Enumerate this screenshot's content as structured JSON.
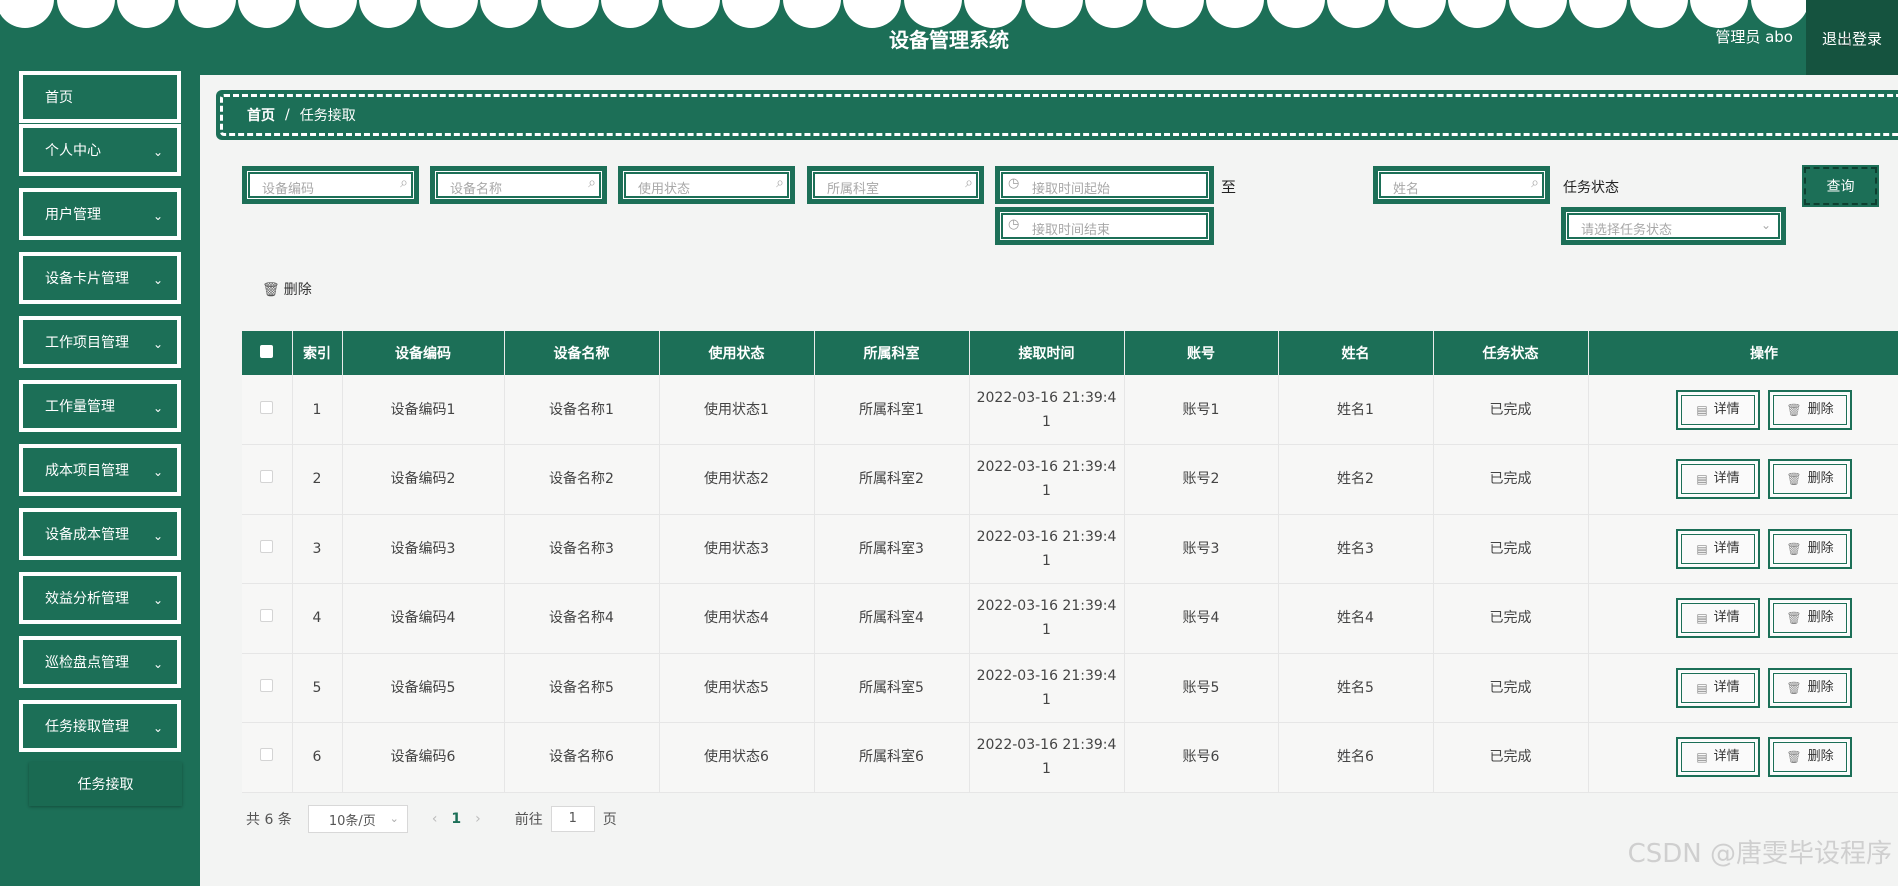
{
  "header": {
    "title": "设备管理系统",
    "user": "管理员 abo",
    "logout": "退出登录"
  },
  "sidebar": {
    "items": [
      {
        "label": "首页",
        "has_chevron": false
      },
      {
        "label": "个人中心",
        "has_chevron": true
      },
      {
        "label": "用户管理",
        "has_chevron": true
      },
      {
        "label": "设备卡片管理",
        "has_chevron": true
      },
      {
        "label": "工作项目管理",
        "has_chevron": true
      },
      {
        "label": "工作量管理",
        "has_chevron": true
      },
      {
        "label": "成本项目管理",
        "has_chevron": true
      },
      {
        "label": "设备成本管理",
        "has_chevron": true
      },
      {
        "label": "效益分析管理",
        "has_chevron": true
      },
      {
        "label": "巡检盘点管理",
        "has_chevron": true
      },
      {
        "label": "任务接取管理",
        "has_chevron": true
      }
    ],
    "submenu": "任务接取"
  },
  "breadcrumb": {
    "home": "首页",
    "sep": "/",
    "current": "任务接取"
  },
  "search": {
    "code_ph": "设备编码",
    "name_ph": "设备名称",
    "status_ph": "使用状态",
    "dept_ph": "所属科室",
    "start_ph": "接取时间起始",
    "to": "至",
    "end_ph": "接取时间结束",
    "person_ph": "姓名",
    "task_status_label": "任务状态",
    "task_status_ph": "请选择任务状态",
    "query": "查询"
  },
  "actions": {
    "bulk_delete": "删除"
  },
  "table": {
    "headers": [
      "索引",
      "设备编码",
      "设备名称",
      "使用状态",
      "所属科室",
      "接取时间",
      "账号",
      "姓名",
      "任务状态",
      "操作"
    ],
    "detail_label": "详情",
    "delete_label": "删除",
    "rows": [
      {
        "idx": "1",
        "code": "设备编码1",
        "name": "设备名称1",
        "status": "使用状态1",
        "dept": "所属科室1",
        "time1": "2022-03-16 21:39:4",
        "time2": "1",
        "account": "账号1",
        "person": "姓名1",
        "task": "已完成"
      },
      {
        "idx": "2",
        "code": "设备编码2",
        "name": "设备名称2",
        "status": "使用状态2",
        "dept": "所属科室2",
        "time1": "2022-03-16 21:39:4",
        "time2": "1",
        "account": "账号2",
        "person": "姓名2",
        "task": "已完成"
      },
      {
        "idx": "3",
        "code": "设备编码3",
        "name": "设备名称3",
        "status": "使用状态3",
        "dept": "所属科室3",
        "time1": "2022-03-16 21:39:4",
        "time2": "1",
        "account": "账号3",
        "person": "姓名3",
        "task": "已完成"
      },
      {
        "idx": "4",
        "code": "设备编码4",
        "name": "设备名称4",
        "status": "使用状态4",
        "dept": "所属科室4",
        "time1": "2022-03-16 21:39:4",
        "time2": "1",
        "account": "账号4",
        "person": "姓名4",
        "task": "已完成"
      },
      {
        "idx": "5",
        "code": "设备编码5",
        "name": "设备名称5",
        "status": "使用状态5",
        "dept": "所属科室5",
        "time1": "2022-03-16 21:39:4",
        "time2": "1",
        "account": "账号5",
        "person": "姓名5",
        "task": "已完成"
      },
      {
        "idx": "6",
        "code": "设备编码6",
        "name": "设备名称6",
        "status": "使用状态6",
        "dept": "所属科室6",
        "time1": "2022-03-16 21:39:4",
        "time2": "1",
        "account": "账号6",
        "person": "姓名6",
        "task": "已完成"
      }
    ]
  },
  "pager": {
    "total": "共 6 条",
    "size": "10条/页",
    "current": "1",
    "goto": "前往",
    "goto_value": "1",
    "page_suffix": "页"
  },
  "watermark": "CSDN @唐雯毕设程序",
  "colors": {
    "primary": "#1c6f57",
    "dark": "#15533f",
    "background": "#f3f4f3"
  }
}
